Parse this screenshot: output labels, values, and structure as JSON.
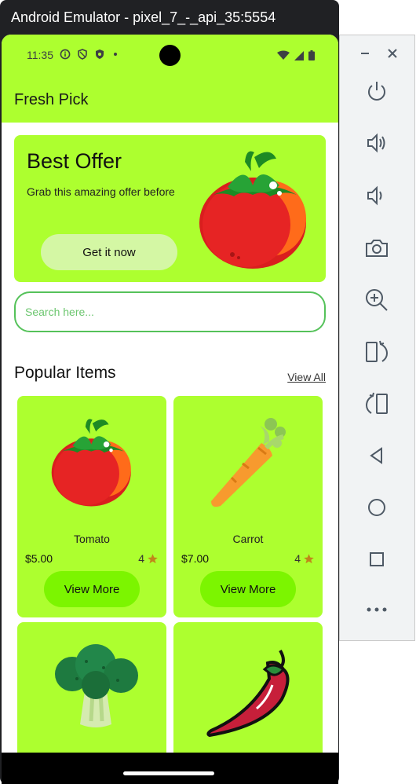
{
  "emulator": {
    "title": "Android Emulator - pixel_7_-_api_35:5554"
  },
  "status_bar": {
    "time": "11:35",
    "left_icons": [
      "info-icon",
      "shield-icon",
      "vpn-icon",
      "dot-icon"
    ],
    "right_icons": [
      "wifi-icon",
      "signal-icon",
      "battery-icon"
    ]
  },
  "app": {
    "title": "Fresh Pick",
    "accent_color": "#adff2f",
    "button_color": "#7cf500"
  },
  "offer": {
    "title": "Best Offer",
    "subtitle": "Grab this amazing offer before",
    "button_label": "Get it now",
    "image": "tomato"
  },
  "search": {
    "placeholder": "Search here..."
  },
  "popular": {
    "title": "Popular Items",
    "view_all_label": "View All",
    "items": [
      {
        "name": "Tomato",
        "price": "$5.00",
        "rating": "4",
        "button_label": "View More",
        "image": "tomato"
      },
      {
        "name": "Carrot",
        "price": "$7.00",
        "rating": "4",
        "button_label": "View More",
        "image": "carrot"
      },
      {
        "name": "",
        "price": "",
        "rating": "",
        "button_label": "",
        "image": "broccoli"
      },
      {
        "name": "",
        "price": "",
        "rating": "",
        "button_label": "",
        "image": "chili-pepper"
      }
    ]
  },
  "side_toolbar": {
    "window_controls": [
      "minimize-icon",
      "close-icon"
    ],
    "buttons": [
      "power-icon",
      "volume-up-icon",
      "volume-down-icon",
      "camera-icon",
      "zoom-icon",
      "rotate-left-icon",
      "rotate-right-icon",
      "back-icon",
      "home-icon",
      "overview-icon",
      "more-icon"
    ]
  }
}
